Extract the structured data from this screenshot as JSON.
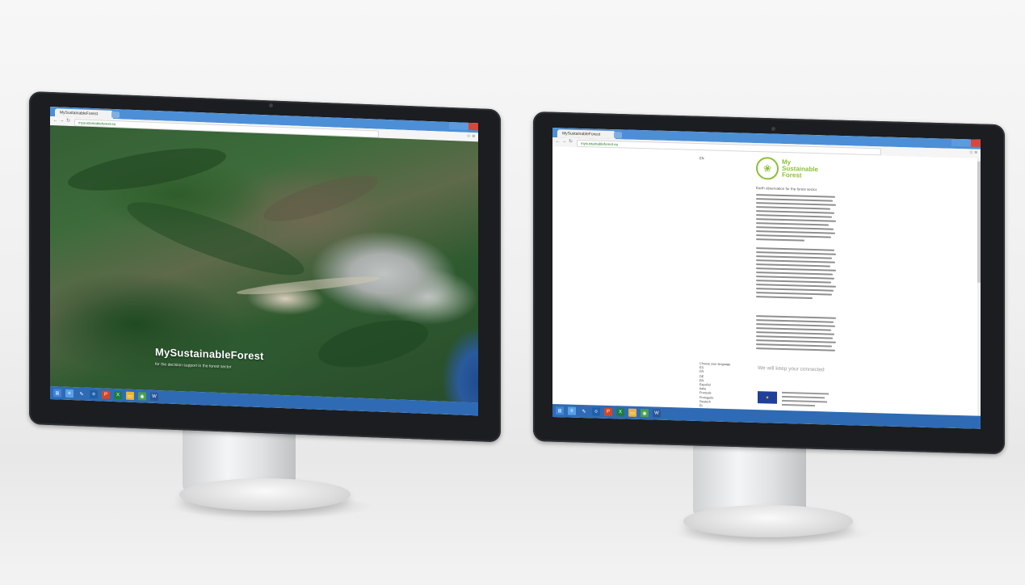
{
  "scene": {
    "background": "#f2f2f2"
  },
  "left_monitor": {
    "browser": {
      "tab_label": "MySustainableForest",
      "url": "mysustainableforest.eu"
    },
    "page": {
      "title": "MySustainableForest",
      "subtitle": "for the decision support in the forest sector"
    },
    "taskbar_icons": [
      "windows-start-icon",
      "ie-icon",
      "folder-icon",
      "outlook-icon",
      "powerpoint-icon",
      "excel-icon",
      "explorer-icon",
      "chrome-icon",
      "word-icon"
    ]
  },
  "right_monitor": {
    "browser": {
      "tab_label": "MySustainableForest",
      "url": "mysustainableforest.eu"
    },
    "page": {
      "top_link": "EN",
      "logo_text_line1": "My",
      "logo_text_line2": "Sustainable",
      "logo_text_line3": "Forest",
      "tagline": "Earth observation for the forest sector",
      "contact_heading": "We will keep your connected",
      "languages_label": "Choose your language",
      "languages": [
        "ES",
        "FR",
        "DE",
        "EN",
        "Español",
        "Italia",
        "Français",
        "Português",
        "Deutsch",
        "EL",
        "PL"
      ]
    },
    "taskbar_icons": [
      "windows-start-icon",
      "ie-icon",
      "folder-icon",
      "outlook-icon",
      "powerpoint-icon",
      "excel-icon",
      "explorer-icon",
      "chrome-icon",
      "word-icon"
    ]
  },
  "colors": {
    "brand_green": "#8dbf3a",
    "taskbar_blue": "#2f6bb5",
    "tabbar_blue": "#4d8fd6",
    "eu_blue": "#1f3f9b"
  }
}
